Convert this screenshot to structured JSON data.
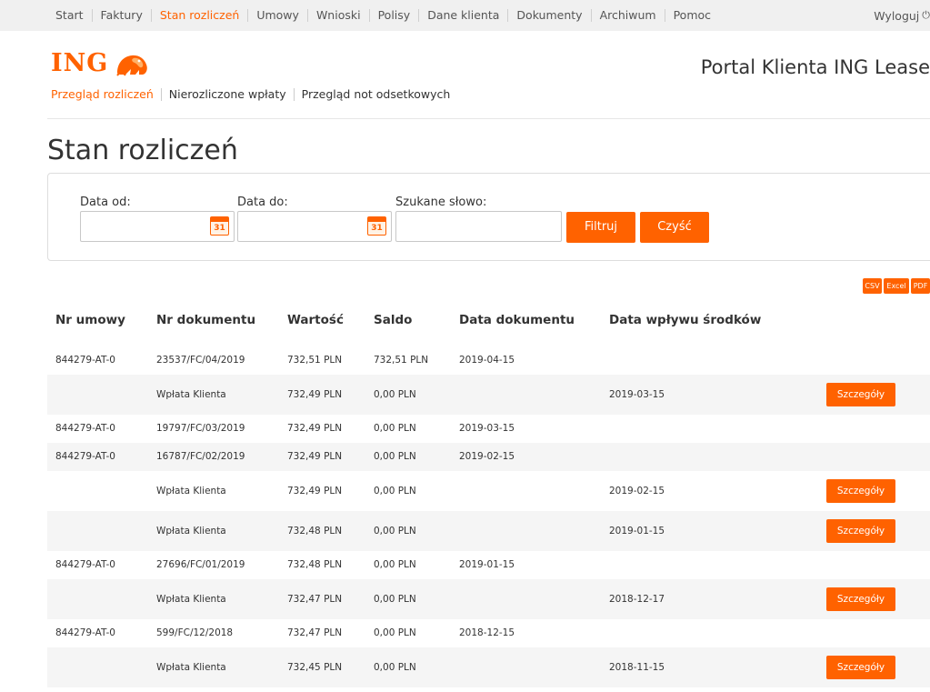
{
  "nav": {
    "items": [
      {
        "label": "Start",
        "active": false
      },
      {
        "label": "Faktury",
        "active": false
      },
      {
        "label": "Stan rozliczeń",
        "active": true
      },
      {
        "label": "Umowy",
        "active": false
      },
      {
        "label": "Wnioski",
        "active": false
      },
      {
        "label": "Polisy",
        "active": false
      },
      {
        "label": "Dane klienta",
        "active": false
      },
      {
        "label": "Dokumenty",
        "active": false
      },
      {
        "label": "Archiwum",
        "active": false
      },
      {
        "label": "Pomoc",
        "active": false
      }
    ],
    "logout_label": "Wyloguj"
  },
  "header": {
    "logo_text": "ING",
    "portal_title": "Portal Klienta ING Lease"
  },
  "subnav": {
    "items": [
      {
        "label": "Przegląd rozliczeń",
        "active": true
      },
      {
        "label": "Nierozliczone wpłaty",
        "active": false
      },
      {
        "label": "Przegląd not odsetkowych",
        "active": false
      }
    ]
  },
  "page_title": "Stan rozliczeń",
  "filter": {
    "date_from_label": "Data od:",
    "date_from_value": "",
    "date_to_label": "Data do:",
    "date_to_value": "",
    "search_label": "Szukane słowo:",
    "search_value": "",
    "calendar_day": "31",
    "filter_button": "Filtruj",
    "clear_button": "Czyść"
  },
  "export": {
    "csv": "CSV",
    "excel": "Excel",
    "pdf": "PDF"
  },
  "table": {
    "columns": [
      "Nr umowy",
      "Nr dokumentu",
      "Wartość",
      "Saldo",
      "Data dokumentu",
      "Data wpływu środków"
    ],
    "details_label": "Szczegóły",
    "rows": [
      {
        "contract": "844279-AT-0",
        "document": "23537/FC/04/2019",
        "value": "732,51 PLN",
        "balance": "732,51 PLN",
        "doc_date": "2019-04-15",
        "payment_date": "",
        "details": false
      },
      {
        "contract": "",
        "document": "Wpłata Klienta",
        "value": "732,49 PLN",
        "balance": "0,00 PLN",
        "doc_date": "",
        "payment_date": "2019-03-15",
        "details": true
      },
      {
        "contract": "844279-AT-0",
        "document": "19797/FC/03/2019",
        "value": "732,49 PLN",
        "balance": "0,00 PLN",
        "doc_date": "2019-03-15",
        "payment_date": "",
        "details": false
      },
      {
        "contract": "844279-AT-0",
        "document": "16787/FC/02/2019",
        "value": "732,49 PLN",
        "balance": "0,00 PLN",
        "doc_date": "2019-02-15",
        "payment_date": "",
        "details": false
      },
      {
        "contract": "",
        "document": "Wpłata Klienta",
        "value": "732,49 PLN",
        "balance": "0,00 PLN",
        "doc_date": "",
        "payment_date": "2019-02-15",
        "details": true
      },
      {
        "contract": "",
        "document": "Wpłata Klienta",
        "value": "732,48 PLN",
        "balance": "0,00 PLN",
        "doc_date": "",
        "payment_date": "2019-01-15",
        "details": true
      },
      {
        "contract": "844279-AT-0",
        "document": "27696/FC/01/2019",
        "value": "732,48 PLN",
        "balance": "0,00 PLN",
        "doc_date": "2019-01-15",
        "payment_date": "",
        "details": false
      },
      {
        "contract": "",
        "document": "Wpłata Klienta",
        "value": "732,47 PLN",
        "balance": "0,00 PLN",
        "doc_date": "",
        "payment_date": "2018-12-17",
        "details": true
      },
      {
        "contract": "844279-AT-0",
        "document": "599/FC/12/2018",
        "value": "732,47 PLN",
        "balance": "0,00 PLN",
        "doc_date": "2018-12-15",
        "payment_date": "",
        "details": false
      },
      {
        "contract": "",
        "document": "Wpłata Klienta",
        "value": "732,45 PLN",
        "balance": "0,00 PLN",
        "doc_date": "",
        "payment_date": "2018-11-15",
        "details": true
      }
    ]
  },
  "colors": {
    "accent": "#ff6200",
    "row_alt": "#f5f5f5",
    "topbar": "#f0f0f0"
  },
  "icons": {
    "calendar": "calendar-icon",
    "logout": "power-icon",
    "logo": "lion-logo-icon"
  }
}
